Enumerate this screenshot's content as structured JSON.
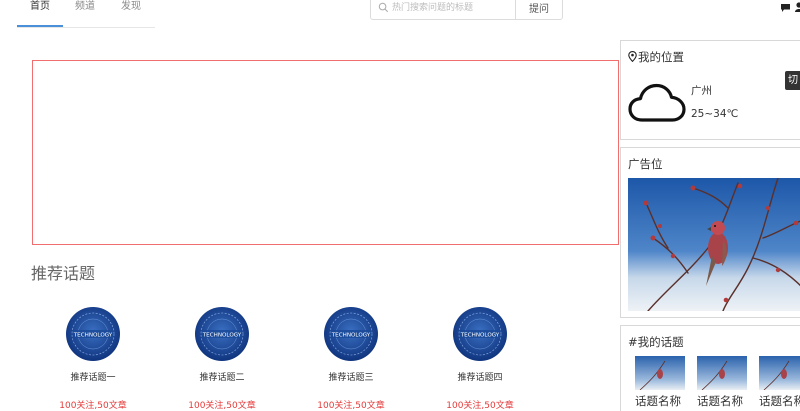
{
  "nav": {
    "items": [
      {
        "label": "首页",
        "active": true
      },
      {
        "label": "频道",
        "active": false
      },
      {
        "label": "发现",
        "active": false
      }
    ],
    "accent_color": "#4a90d9"
  },
  "search": {
    "placeholder": "热门搜索问题的标题",
    "icon": "search-icon"
  },
  "ask_button": {
    "label": "提问"
  },
  "header_icons": [
    "message-icon",
    "user-icon"
  ],
  "banner": {
    "border_color": "#f26d6d"
  },
  "recommend": {
    "title": "推荐话题",
    "image_label": "TECHNOLOGY",
    "topics": [
      {
        "name": "推荐话题一",
        "stats": "100关注,50文章"
      },
      {
        "name": "推荐话题二",
        "stats": "100关注,50文章"
      },
      {
        "name": "推荐话题三",
        "stats": "100关注,50文章"
      },
      {
        "name": "推荐话题四",
        "stats": "100关注,50文章"
      }
    ],
    "stats_color": "#e43b3b"
  },
  "location": {
    "title": "我的位置",
    "city": "广州",
    "temperature": "25~34℃",
    "weather_icon": "cloud-icon"
  },
  "switch_tip": {
    "label": "切"
  },
  "ad": {
    "title": "广告位"
  },
  "my_topics": {
    "title": "#我的话题",
    "items": [
      {
        "name": "话题名称"
      },
      {
        "name": "话题名称"
      },
      {
        "name": "话题名称"
      }
    ]
  }
}
